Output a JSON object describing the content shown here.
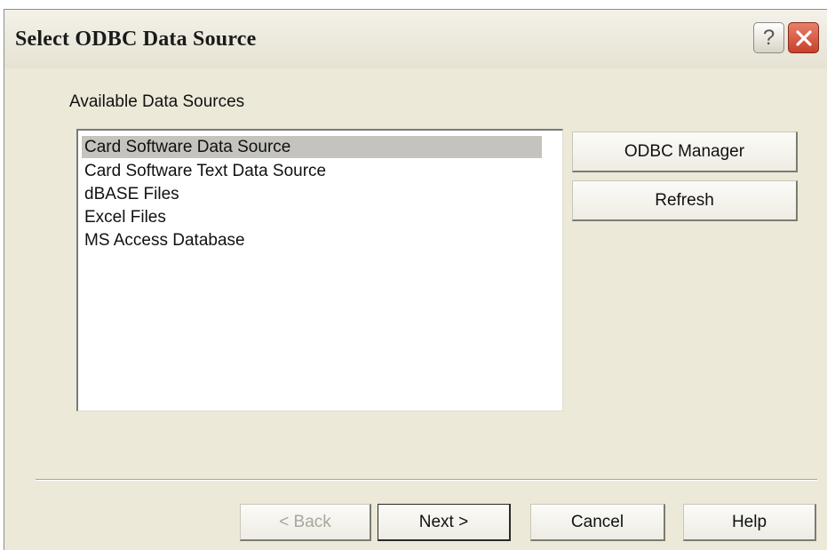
{
  "window": {
    "title": "Select ODBC Data Source",
    "help_glyph": "?",
    "icons": [
      "help-icon",
      "close-icon"
    ]
  },
  "sources": {
    "label": "Available Data Sources",
    "items": [
      {
        "label": "Card Software Data Source",
        "selected": true
      },
      {
        "label": "Card Software Text Data Source",
        "selected": false
      },
      {
        "label": "dBASE Files",
        "selected": false
      },
      {
        "label": "Excel Files",
        "selected": false
      },
      {
        "label": "MS Access Database",
        "selected": false
      }
    ]
  },
  "side_buttons": {
    "odbc_manager": "ODBC Manager",
    "refresh": "Refresh"
  },
  "footer": {
    "back": "< Back",
    "next": "Next >",
    "cancel": "Cancel",
    "help": "Help"
  },
  "colors": {
    "dialog_bg": "#ece9d8",
    "selection": "#c4c3bd",
    "close_button": "#c8402c"
  }
}
